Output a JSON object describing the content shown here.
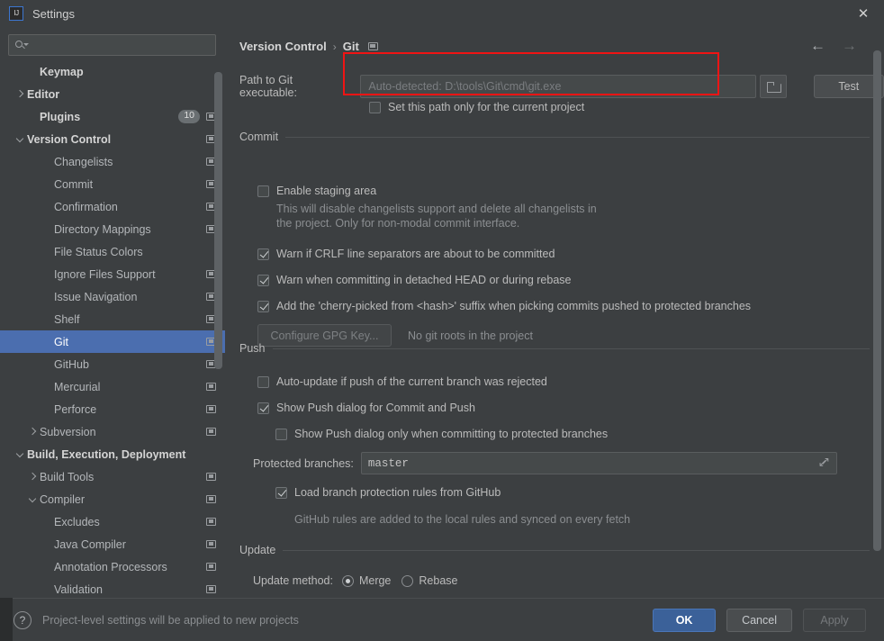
{
  "window": {
    "title": "Settings",
    "app_icon": "IJ",
    "close_label": "✕"
  },
  "sidebar": {
    "search": {
      "value": "",
      "placeholder": ""
    },
    "items": [
      {
        "label": "Keymap",
        "indent": 1,
        "bold": true,
        "arrow": "none",
        "icon": false,
        "selected": false
      },
      {
        "label": "Editor",
        "indent": 0,
        "bold": true,
        "arrow": "right",
        "icon": false,
        "selected": false
      },
      {
        "label": "Plugins",
        "indent": 1,
        "bold": true,
        "arrow": "none",
        "icon": true,
        "badge": "10",
        "selected": false
      },
      {
        "label": "Version Control",
        "indent": 0,
        "bold": true,
        "arrow": "down",
        "icon": true,
        "selected": false
      },
      {
        "label": "Changelists",
        "indent": 2,
        "bold": false,
        "arrow": "none",
        "icon": true,
        "selected": false
      },
      {
        "label": "Commit",
        "indent": 2,
        "bold": false,
        "arrow": "none",
        "icon": true,
        "selected": false
      },
      {
        "label": "Confirmation",
        "indent": 2,
        "bold": false,
        "arrow": "none",
        "icon": true,
        "selected": false
      },
      {
        "label": "Directory Mappings",
        "indent": 2,
        "bold": false,
        "arrow": "none",
        "icon": true,
        "selected": false
      },
      {
        "label": "File Status Colors",
        "indent": 2,
        "bold": false,
        "arrow": "none",
        "icon": false,
        "selected": false
      },
      {
        "label": "Ignore Files Support",
        "indent": 2,
        "bold": false,
        "arrow": "none",
        "icon": true,
        "selected": false
      },
      {
        "label": "Issue Navigation",
        "indent": 2,
        "bold": false,
        "arrow": "none",
        "icon": true,
        "selected": false
      },
      {
        "label": "Shelf",
        "indent": 2,
        "bold": false,
        "arrow": "none",
        "icon": true,
        "selected": false
      },
      {
        "label": "Git",
        "indent": 2,
        "bold": false,
        "arrow": "none",
        "icon": true,
        "selected": true
      },
      {
        "label": "GitHub",
        "indent": 2,
        "bold": false,
        "arrow": "none",
        "icon": true,
        "selected": false
      },
      {
        "label": "Mercurial",
        "indent": 2,
        "bold": false,
        "arrow": "none",
        "icon": true,
        "selected": false
      },
      {
        "label": "Perforce",
        "indent": 2,
        "bold": false,
        "arrow": "none",
        "icon": true,
        "selected": false
      },
      {
        "label": "Subversion",
        "indent": 1,
        "bold": false,
        "arrow": "right",
        "icon": true,
        "selected": false
      },
      {
        "label": "Build, Execution, Deployment",
        "indent": 0,
        "bold": true,
        "arrow": "down",
        "icon": false,
        "selected": false
      },
      {
        "label": "Build Tools",
        "indent": 1,
        "bold": false,
        "arrow": "right",
        "icon": true,
        "selected": false
      },
      {
        "label": "Compiler",
        "indent": 1,
        "bold": false,
        "arrow": "down",
        "icon": true,
        "selected": false
      },
      {
        "label": "Excludes",
        "indent": 2,
        "bold": false,
        "arrow": "none",
        "icon": true,
        "selected": false
      },
      {
        "label": "Java Compiler",
        "indent": 2,
        "bold": false,
        "arrow": "none",
        "icon": true,
        "selected": false
      },
      {
        "label": "Annotation Processors",
        "indent": 2,
        "bold": false,
        "arrow": "none",
        "icon": true,
        "selected": false
      },
      {
        "label": "Validation",
        "indent": 2,
        "bold": false,
        "arrow": "none",
        "icon": true,
        "selected": false
      }
    ]
  },
  "content": {
    "breadcrumb": {
      "root": "Version Control",
      "separator": "›",
      "current": "Git"
    },
    "nav": {
      "back": "←",
      "forward": "→"
    },
    "git_path": {
      "label": "Path to Git executable:",
      "value": "",
      "placeholder": "Auto-detected: D:\\tools\\Git\\cmd\\git.exe",
      "test_button": "Test",
      "project_only_checkbox": {
        "label": "Set this path only for the current project",
        "checked": false
      }
    },
    "commit": {
      "title": "Commit",
      "enable_staging": {
        "label": "Enable staging area",
        "checked": false
      },
      "staging_hint_line1": "This will disable changelists support and delete all changelists in",
      "staging_hint_line2": "the project. Only for non-modal commit interface.",
      "warn_crlf": {
        "label": "Warn if CRLF line separators are about to be committed",
        "checked": true
      },
      "warn_detached": {
        "label": "Warn when committing in detached HEAD or during rebase",
        "checked": true
      },
      "cherry_picked": {
        "label": "Add the 'cherry-picked from <hash>' suffix when picking commits pushed to protected branches",
        "checked": true
      },
      "gpg_button": "Configure GPG Key...",
      "gpg_status": "No git roots in the project"
    },
    "push": {
      "title": "Push",
      "auto_update": {
        "label": "Auto-update if push of the current branch was rejected",
        "checked": false
      },
      "show_push_dialog": {
        "label": "Show Push dialog for Commit and Push",
        "checked": true
      },
      "show_push_protected": {
        "label": "Show Push dialog only when committing to protected branches",
        "checked": false
      },
      "protected_branches_label": "Protected branches:",
      "protected_branches_value": "master",
      "load_rules": {
        "label": "Load branch protection rules from GitHub",
        "checked": true
      },
      "load_rules_hint": "GitHub rules are added to the local rules and synced on every fetch"
    },
    "update": {
      "title": "Update",
      "method_label": "Update method:",
      "options": [
        {
          "label": "Merge",
          "selected": true
        },
        {
          "label": "Rebase",
          "selected": false
        }
      ]
    }
  },
  "footer": {
    "help_glyph": "?",
    "note": "Project-level settings will be applied to new projects",
    "ok": "OK",
    "cancel": "Cancel",
    "apply": "Apply"
  },
  "colors": {
    "background": "#3c3f41",
    "selection": "#4b6eaf",
    "accent": "#3b6199",
    "highlight_box": "#f01414",
    "field_bg": "#45494a"
  }
}
